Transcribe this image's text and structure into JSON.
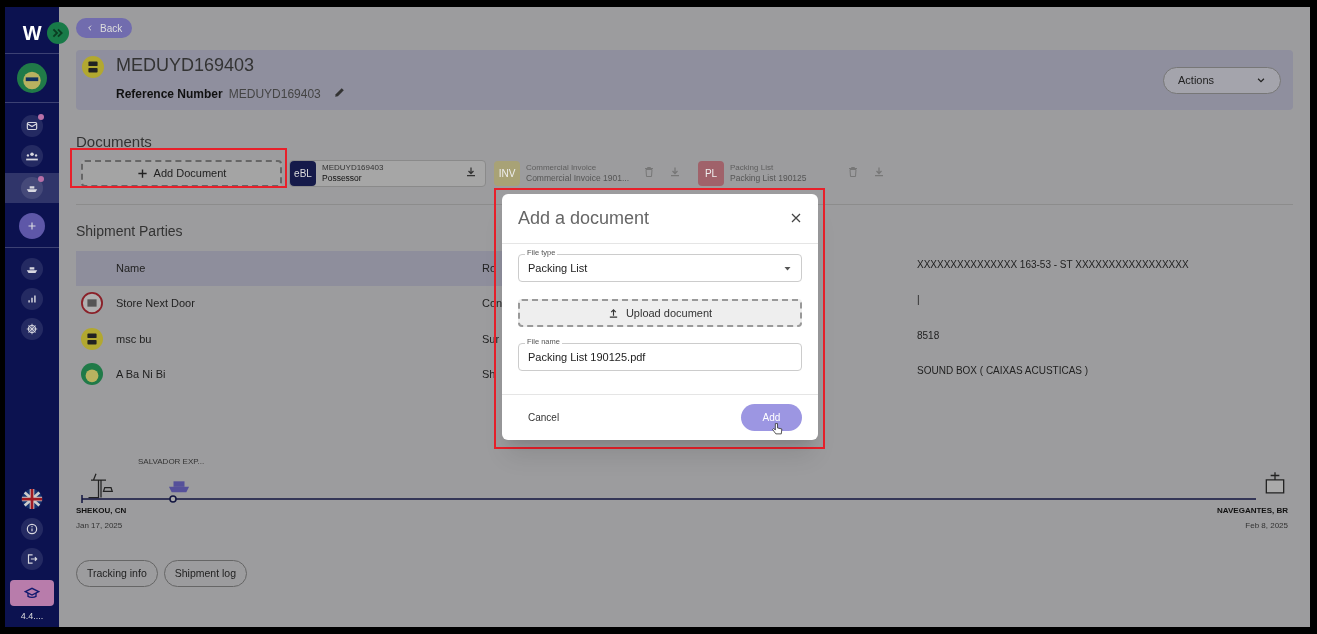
{
  "sidebar": {
    "logo": "W",
    "version": "4.4....",
    "items": [
      {
        "badge": true,
        "selected": false
      },
      {
        "badge": false,
        "selected": false
      },
      {
        "badge": true,
        "selected": true
      },
      {
        "badge": false,
        "selected": false
      },
      {
        "badge": false,
        "selected": false
      },
      {
        "badge": false,
        "selected": false
      },
      {
        "badge": false,
        "selected": false
      }
    ]
  },
  "back_button": "Back",
  "header": {
    "title": "MEDUYD169403",
    "reference_label": "Reference Number",
    "reference_value": "MEDUYD169403",
    "actions": "Actions"
  },
  "documents": {
    "title": "Documents",
    "add_button": "Add Document",
    "items": [
      {
        "badge": "eBL",
        "color": "#151a4a",
        "title": "MEDUYD169403",
        "subtitle": "Possessor",
        "faded": false,
        "deletable": false
      },
      {
        "badge": "INV",
        "color": "#a8a276",
        "title": "Commercial Invoice",
        "subtitle": "Commercial Invoice 1901...",
        "faded": true,
        "deletable": true
      },
      {
        "badge": "PL",
        "color": "#a0626a",
        "title": "Packing List",
        "subtitle": "Packing List 190125",
        "faded": true,
        "deletable": true
      }
    ]
  },
  "parties": {
    "title": "Shipment Parties",
    "columns": [
      "Name",
      "Ro"
    ],
    "rows": [
      {
        "name": "Store Next Door",
        "role": "Con"
      },
      {
        "name": "msc bu",
        "role": "Sur"
      },
      {
        "name": "A Ba Ni Bi",
        "role": "Sh"
      }
    ]
  },
  "details": {
    "values": [
      "XXXXXXXXXXXXXXX 163-53 - ST XXXXXXXXXXXXXXXXX",
      "|",
      "8518",
      "SOUND BOX ( CAIXAS ACUSTICAS )"
    ]
  },
  "timeline": {
    "vessel": "SALVADOR EXP...",
    "origin": {
      "port": "SHEKOU, CN",
      "date": "Jan 17, 2025"
    },
    "destination": {
      "port": "NAVEGANTES, BR",
      "date": "Feb 8, 2025"
    }
  },
  "footer_buttons": [
    "Tracking info",
    "Shipment log"
  ],
  "dialog": {
    "title": "Add a document",
    "file_type_label": "File type",
    "file_type": "Packing List",
    "upload": "Upload document",
    "file_name_label": "File name",
    "file_name": "Packing List 190125.pdf",
    "cancel": "Cancel",
    "add": "Add"
  }
}
